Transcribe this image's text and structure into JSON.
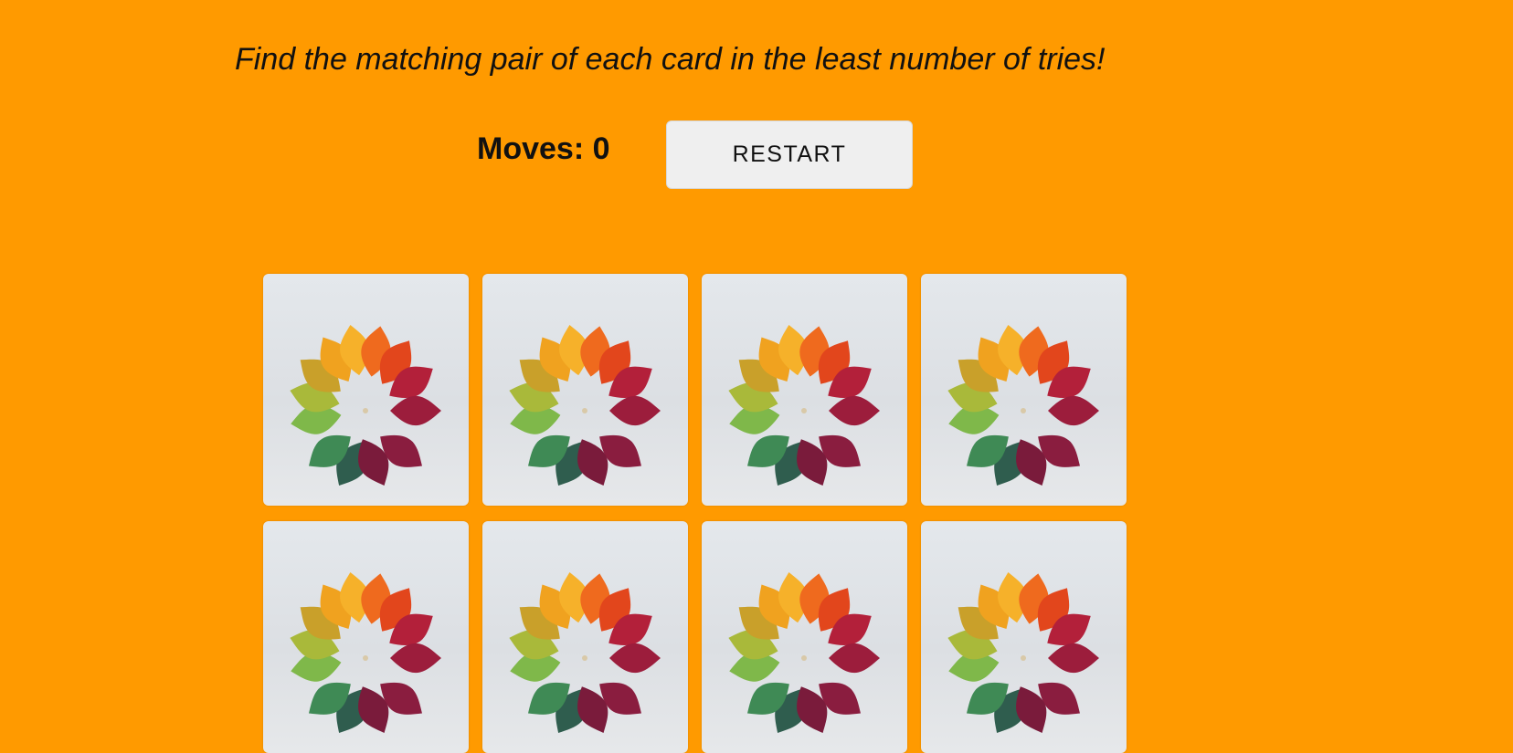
{
  "instructions": "Find the matching pair of each card in the least number of tries!",
  "score": {
    "label": "Moves:",
    "value": "0"
  },
  "restart_label": "RESTART",
  "board": {
    "columns": 4,
    "cards": [
      {
        "face": "down",
        "back_image": "autumn-leaves-fan"
      },
      {
        "face": "down",
        "back_image": "autumn-leaves-fan"
      },
      {
        "face": "down",
        "back_image": "autumn-leaves-fan"
      },
      {
        "face": "down",
        "back_image": "autumn-leaves-fan"
      },
      {
        "face": "down",
        "back_image": "autumn-leaves-fan"
      },
      {
        "face": "down",
        "back_image": "autumn-leaves-fan"
      },
      {
        "face": "down",
        "back_image": "autumn-leaves-fan"
      },
      {
        "face": "down",
        "back_image": "autumn-leaves-fan"
      }
    ]
  },
  "colors": {
    "background": "#ff9a00",
    "card_back": "#e2e5e9",
    "button": "#efefef"
  }
}
